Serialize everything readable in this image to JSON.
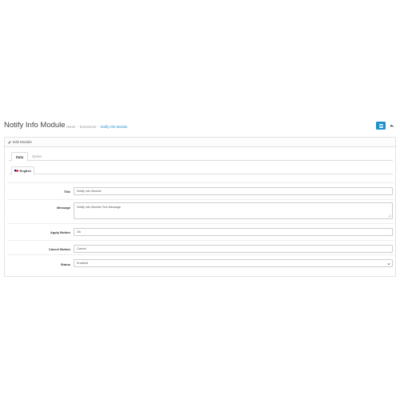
{
  "header": {
    "title": "Notify Info Module",
    "breadcrumb": [
      {
        "label": "Home"
      },
      {
        "label": "Extensions"
      },
      {
        "label": "Notify Info Module"
      }
    ]
  },
  "panel": {
    "heading": "Edit Module"
  },
  "tabs": [
    {
      "label": "Data",
      "active": true
    },
    {
      "label": "Option",
      "active": false
    }
  ],
  "language_tab": {
    "label": "English"
  },
  "form": {
    "title": {
      "label": "Title",
      "value": "Notify Info Module"
    },
    "message": {
      "label": "Message",
      "value": "Notify Info Module Text Message"
    },
    "apply_button": {
      "label": "Apply Button",
      "value": "Ok"
    },
    "cancel_button": {
      "label": "Cancel Button",
      "value": "Cancel"
    },
    "status": {
      "label": "Status",
      "value": "Enabled"
    }
  },
  "icons": {
    "save": "save-icon",
    "back": "reply-icon",
    "heading": "pencil-icon"
  },
  "colors": {
    "primary": "#1e91cf"
  }
}
